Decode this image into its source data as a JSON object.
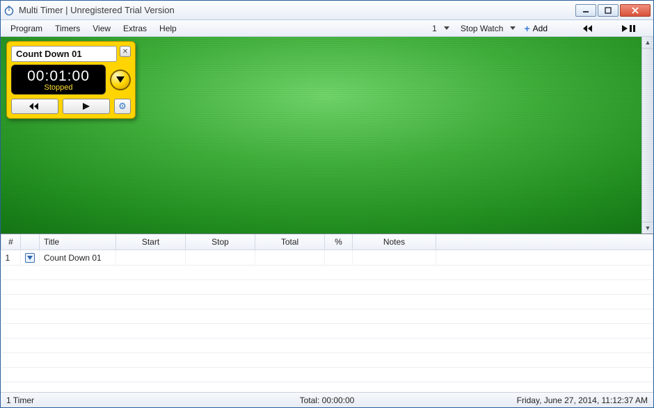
{
  "window": {
    "title": "Multi Timer | Unregistered Trial Version"
  },
  "menu": {
    "items": [
      "Program",
      "Timers",
      "View",
      "Extras",
      "Help"
    ]
  },
  "toolbar": {
    "count": "1",
    "mode": "Stop Watch",
    "add_label": "Add"
  },
  "timer_widget": {
    "title": "Count Down 01",
    "time": "00:01:00",
    "status": "Stopped"
  },
  "table": {
    "headers": {
      "num": "#",
      "icon": "",
      "title": "Title",
      "start": "Start",
      "stop": "Stop",
      "total": "Total",
      "pct": "%",
      "notes": "Notes"
    },
    "rows": [
      {
        "num": "1",
        "title": "Count Down 01",
        "start": "",
        "stop": "",
        "total": "",
        "pct": "",
        "notes": ""
      }
    ]
  },
  "status": {
    "left": "1 Timer",
    "center": "Total: 00:00:00",
    "right": "Friday, June 27, 2014, 11:12:37 AM"
  }
}
